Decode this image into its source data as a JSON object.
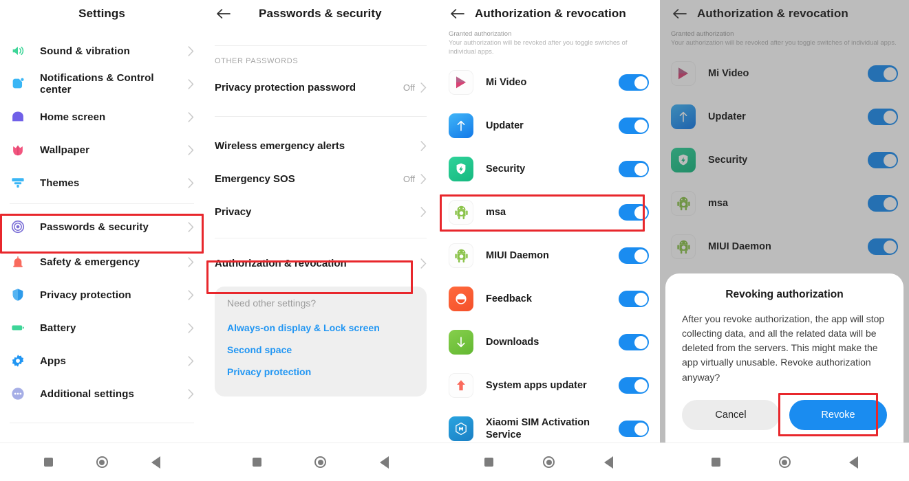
{
  "panel1": {
    "title": "Settings",
    "items": [
      {
        "label": "Sound & vibration",
        "icon": "speaker-icon",
        "chevron": ">"
      },
      {
        "label": "Notifications & Control center",
        "icon": "notification-icon",
        "chevron": ">"
      },
      {
        "label": "Home screen",
        "icon": "home-icon",
        "chevron": ">"
      },
      {
        "label": "Wallpaper",
        "icon": "flower-icon",
        "chevron": ">"
      },
      {
        "label": "Themes",
        "icon": "brush-icon",
        "chevron": ">"
      },
      {
        "label": "Passwords & security",
        "icon": "fingerprint-icon",
        "chevron": ">"
      },
      {
        "label": "Safety & emergency",
        "icon": "siren-icon",
        "chevron": ">"
      },
      {
        "label": "Privacy protection",
        "icon": "shield-icon",
        "chevron": ">"
      },
      {
        "label": "Battery",
        "icon": "battery-icon",
        "chevron": ">"
      },
      {
        "label": "Apps",
        "icon": "gear-icon",
        "chevron": ">"
      },
      {
        "label": "Additional settings",
        "icon": "ellipsis-icon",
        "chevron": ">"
      }
    ],
    "highlighted_item": "Passwords & security"
  },
  "panel2": {
    "title": "Passwords & security",
    "back_icon": "back-arrow-icon",
    "group_caption": "OTHER PASSWORDS",
    "rows": [
      {
        "label": "Privacy protection password",
        "value": "Off",
        "chevron": ">"
      },
      {
        "label": "Wireless emergency alerts",
        "value": "",
        "chevron": ">"
      },
      {
        "label": "Emergency SOS",
        "value": "Off",
        "chevron": ">"
      },
      {
        "label": "Privacy",
        "value": "",
        "chevron": ">"
      },
      {
        "label": "Authorization & revocation",
        "value": "",
        "chevron": ">"
      }
    ],
    "highlighted_item": "Authorization & revocation",
    "need_card": {
      "title": "Need other settings?",
      "links": [
        "Always-on display & Lock screen",
        "Second space",
        "Privacy protection"
      ]
    }
  },
  "panel3": {
    "title": "Authorization & revocation",
    "back_icon": "back-arrow-icon",
    "note_title": "Granted authorization",
    "note_body": "Your authorization will be revoked after you toggle switches of individual apps.",
    "apps": [
      {
        "name": "Mi Video",
        "icon": "mi-video-icon",
        "toggle": "on"
      },
      {
        "name": "Updater",
        "icon": "updater-icon",
        "toggle": "on"
      },
      {
        "name": "Security",
        "icon": "security-icon",
        "toggle": "on"
      },
      {
        "name": "msa",
        "icon": "android-icon",
        "toggle": "on"
      },
      {
        "name": "MIUI Daemon",
        "icon": "android-icon",
        "toggle": "on"
      },
      {
        "name": "Feedback",
        "icon": "feedback-icon",
        "toggle": "on"
      },
      {
        "name": "Downloads",
        "icon": "downloads-icon",
        "toggle": "on"
      },
      {
        "name": "System apps updater",
        "icon": "arrow-up-icon",
        "toggle": "on"
      },
      {
        "name": "Xiaomi SIM Activation Service",
        "icon": "mi-icon",
        "toggle": "on"
      }
    ],
    "highlighted_item": "msa"
  },
  "panel4": {
    "title": "Authorization & revocation",
    "back_icon": "back-arrow-icon",
    "note_title": "Granted authorization",
    "note_body": "Your authorization will be revoked after you toggle switches of individual apps.",
    "apps": [
      {
        "name": "Mi Video",
        "icon": "mi-video-icon",
        "toggle": "on"
      },
      {
        "name": "Updater",
        "icon": "updater-icon",
        "toggle": "on"
      },
      {
        "name": "Security",
        "icon": "security-icon",
        "toggle": "on"
      },
      {
        "name": "msa",
        "icon": "android-icon",
        "toggle": "on"
      },
      {
        "name": "MIUI Daemon",
        "icon": "android-icon",
        "toggle": "on"
      }
    ],
    "dialog": {
      "title": "Revoking authorization",
      "body": "After you revoke authorization, the app will stop collecting data, and all the related data will be deleted from the servers. This might make the app virtually unusable. Revoke authorization anyway?",
      "cancel_label": "Cancel",
      "revoke_label": "Revoke",
      "highlighted_button": "Revoke"
    }
  },
  "navbar": {
    "recents_icon": "square-icon",
    "home_icon": "circle-icon",
    "back_icon": "triangle-back-icon"
  },
  "colors": {
    "accent_blue": "#1a8cf0",
    "link_blue": "#2196f3",
    "highlight_red": "#e8272c",
    "text_primary": "#1b1b1b",
    "text_muted": "#9e9e9e"
  }
}
